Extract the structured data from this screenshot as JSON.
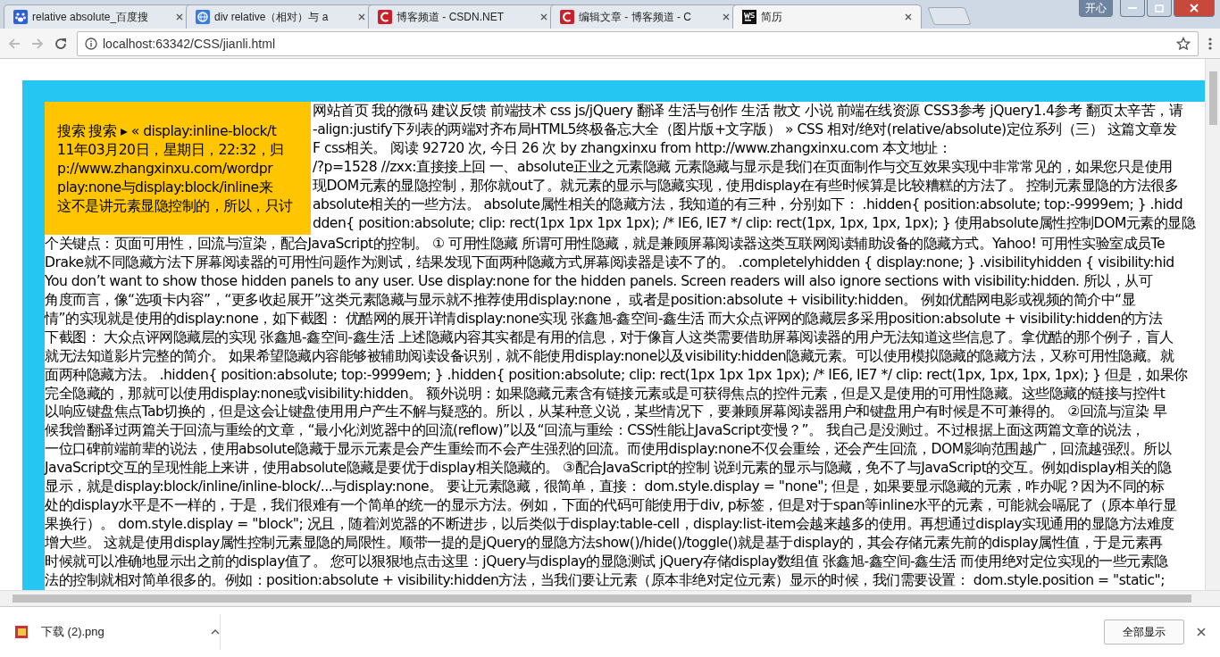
{
  "tabs": [
    {
      "title": "relative absolute_百度搜",
      "kind": "paw",
      "selected": false
    },
    {
      "title": "div relative（相对）与 a",
      "kind": "globe",
      "selected": false
    },
    {
      "title": "博客频道 - CSDN.NET",
      "kind": "csdn",
      "selected": false
    },
    {
      "title": "编辑文章 - 博客频道 - C",
      "kind": "csdn",
      "selected": false
    },
    {
      "title": "简历",
      "kind": "ws",
      "selected": true
    }
  ],
  "window_badge": "开心",
  "address_bar": {
    "url": "localhost:63342/CSS/jianli.html"
  },
  "article": {
    "lines": [
      {
        "kind": "split",
        "right": "网站首页 我的微码 建议反馈 前端技术 css js/jQuery 翻译 生活与创作 生活 散文 小说 前端在线资源 CSS3参考 jQuery1.4参考 翻页太辛苦，请"
      },
      {
        "kind": "split",
        "left": "搜索 搜索 ▸ « display:inline-block/t",
        "right": "-align:justify下列表的两端对齐布局HTML5终极备忘大全（图片版+文字版） » CSS 相对/绝对(relative/absolute)定位系列（三） 这篇文章发"
      },
      {
        "kind": "split",
        "left": "11年03月20日，星期日，22:32，归",
        "right": "F css相关。 阅读 92720 次, 今日 26 次 by zhangxinxu from http://www.zhangxinxu.com 本文地址："
      },
      {
        "kind": "split",
        "left": "p://www.zhangxinxu.com/wordpr",
        "right": "/?p=1528 //zxx:直接接上回 一、absolute正业之元素隐藏 元素隐藏与显示是我们在页面制作与交互效果实现中非常常见的，如果您只是使用"
      },
      {
        "kind": "split",
        "left": "play:none与display:block/inline来",
        "right": "现DOM元素的显隐控制，那你就out了。就元素的显示与隐藏实现，使用display在有些时候算是比较糟糕的方法了。 控制元素显隐的方法很多"
      },
      {
        "kind": "split",
        "left": "这不是讲元素显隐控制的，所以，只讨",
        "right": "absolute相关的一些方法。 absolute属性相关的隐藏方法，我知道的有三种，分别如下： .hidden{ position:absolute; top:-9999em; } .hidd"
      },
      {
        "kind": "split",
        "right": "dden{ position:absolute; clip: rect(1px 1px 1px 1px); /* IE6, IE7 */ clip: rect(1px, 1px, 1px, 1px); } 使用absolute属性控制DOM元素的显隐"
      },
      {
        "kind": "full",
        "text": "个关键点：页面可用性，回流与渲染，配合JavaScript的控制。 ① 可用性隐藏 所谓可用性隐藏，就是兼顾屏幕阅读器这类互联网阅读辅助设备的隐藏方式。Yahoo! 可用性实验室成员Te"
      },
      {
        "kind": "full",
        "text": "Drake就不同隐藏方法下屏幕阅读器的可用性问题作为测试，结果发现下面两种隐藏方式屏幕阅读器是读不了的。 .completelyhidden { display:none; } .visibilityhidden { visibility:hid"
      },
      {
        "kind": "full",
        "text": "You don’t want to show those hidden panels to any user. Use display:none for the hidden panels. Screen readers will also ignore sections with visibility:hidden. 所以，从可"
      },
      {
        "kind": "full",
        "text": "角度而言，像“选项卡内容”，“更多收起展开”这类元素隐藏与显示就不推荐使用display:none， 或者是position:absolute + visibility:hidden。 例如优酷网电影或视频的简介中“显"
      },
      {
        "kind": "full",
        "text": "情”的实现就是使用的display:none，如下截图： 优酷网的展开详情display:none实现 张鑫旭-鑫空间-鑫生活 而大众点评网的隐藏层多采用position:absolute + visibility:hidden的方法"
      },
      {
        "kind": "full",
        "text": "下截图： 大众点评网隐藏层的实现 张鑫旭-鑫空间-鑫生活 上述隐藏内容其实都是有用的信息，对于像盲人这类需要借助屏幕阅读器的用户无法知道这些信息了。拿优酷的那个例子，盲人"
      },
      {
        "kind": "full",
        "text": "就无法知道影片完整的简介。 如果希望隐藏内容能够被辅助阅读设备识别，就不能使用display:none以及visibility:hidden隐藏元素。可以使用模拟隐藏的隐藏方法，又称可用性隐藏。就"
      },
      {
        "kind": "full",
        "text": "面两种隐藏方法。 .hidden{ position:absolute; top:-9999em; } .hidden{ position:absolute; clip: rect(1px 1px 1px 1px); /* IE6, IE7 */ clip: rect(1px, 1px, 1px, 1px); } 但是，如果你"
      },
      {
        "kind": "full",
        "text": "完全隐藏的，那就可以使用display:none或visibility:hidden。 额外说明：如果隐藏元素含有链接元素或是可获得焦点的控件元素，但是又是使用的可用性隐藏。这些隐藏的链接与控件t"
      },
      {
        "kind": "full",
        "text": "以响应键盘焦点Tab切换的，但是这会让键盘使用用户产生不解与疑惑的。所以，从某种意义说，某些情况下，要兼顾屏幕阅读器用户和键盘用户有时候是不可兼得的。 ②回流与渲染 早"
      },
      {
        "kind": "full",
        "text": "候我曾翻译过两篇关于回流与重绘的文章，“最小化浏览器中的回流(reflow)”以及“回流与重绘：CSS性能让JavaScript变慢？”。 我自己是没测过。不过根据上面这两篇文章的说法，"
      },
      {
        "kind": "full",
        "text": "一位口碑前端前辈的说法，使用absolute隐藏于显示元素是会产生重绘而不会产生强烈的回流。而使用display:none不仅会重绘，还会产生回流，DOM影响范围越广，回流越强烈。所以"
      },
      {
        "kind": "full",
        "text": "JavaScript交互的呈现性能上来讲，使用absolute隐藏是要优于display相关隐藏的。 ③配合JavaScript的控制 说到元素的显示与隐藏，免不了与JavaScript的交互。例如display相关的隐"
      },
      {
        "kind": "full",
        "text": "显示，就是display:block/inline/inline-block/...与display:none。 要让元素隐藏，很简单，直接： dom.style.display = \"none\"; 但是，如果要显示隐藏的元素，咋办呢？因为不同的标"
      },
      {
        "kind": "full",
        "text": "处的display水平是不一样的，于是，我们很难有一个简单的统一的显示方法。例如，下面的代码可能使用于div, p标签，但是对于span等inline水平的元素，可能就会嗝屁了（原本单行显"
      },
      {
        "kind": "full",
        "text": "果换行）。 dom.style.display = \"block\"; 况且，随着浏览器的不断进步，以后类似于display:table-cell，display:list-item会越来越多的使用。再想通过display实现通用的显隐方法难度"
      },
      {
        "kind": "full",
        "text": "增大些。 这就是使用display属性控制元素显隐的局限性。顺带一提的是jQuery的显隐方法show()/hide()/toggle()就是基于display的，其会存储元素先前的display属性值，于是元素再"
      },
      {
        "kind": "full",
        "text": "时候就可以准确地显示出之前的display值了。 您可以狠狠地点击这里：jQuery与display的显隐测试 jQuery存储display数组值 张鑫旭-鑫空间-鑫生活 而使用绝对定位实现的一些元素隐"
      },
      {
        "kind": "full",
        "text": "法的控制就相对简单很多的。例如：position:absolute + visibility:hidden方法，当我们要让元素（原本非绝对定位元素）显示的时候，我们需要设置： dom.style.position = \"static\";"
      }
    ]
  },
  "download_bar": {
    "file": "下载 (2).png",
    "show_all": "全部显示"
  }
}
